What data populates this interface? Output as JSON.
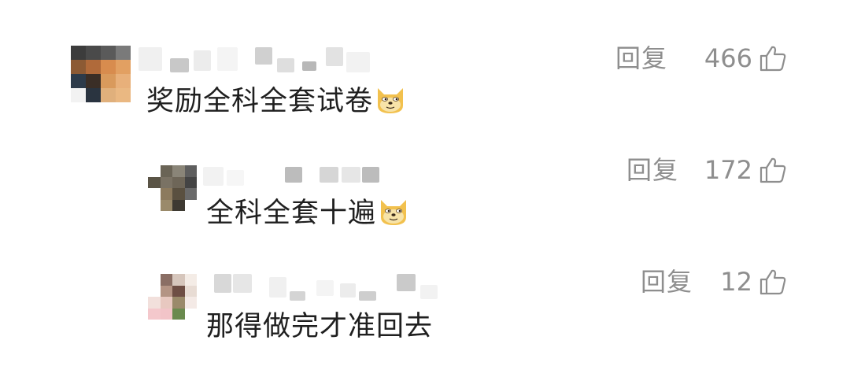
{
  "comments": [
    {
      "text": "奖励全科全套试卷",
      "emoji": "doge-emoji",
      "reply_label": "回复",
      "likes": "466",
      "like_icon": "thumbs-up-icon"
    },
    {
      "text": "全科全套十遍",
      "emoji": "doge-emoji",
      "reply_label": "回复",
      "likes": "172",
      "like_icon": "thumbs-up-icon"
    },
    {
      "text": "那得做完才准回去",
      "reply_label": "回复",
      "likes": "12",
      "like_icon": "thumbs-up-icon"
    }
  ],
  "colors": {
    "text": "#1f1f1f",
    "meta": "#8e8e8e",
    "background": "#ffffff"
  }
}
